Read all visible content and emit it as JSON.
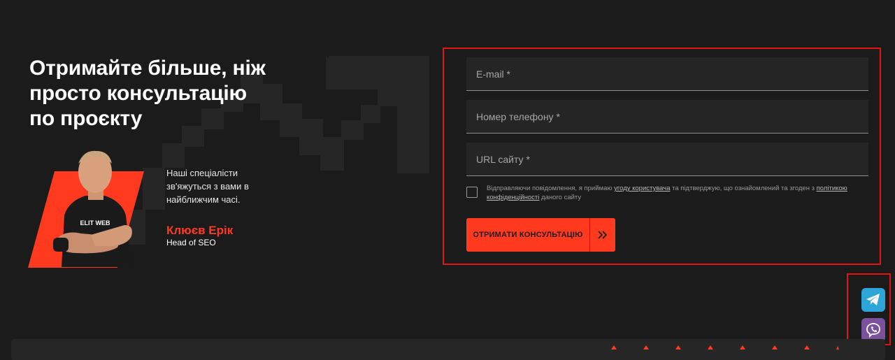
{
  "hero": {
    "title": "Отримайте більше, ніж\nпросто консультацію\nпо проєкту"
  },
  "expert": {
    "description": "Наші спеціалісти\nзв'яжуться з вами в\nнайближчим часі.",
    "name": "Клюєв Ерік",
    "role": "Head of SEO",
    "shirt_text": "ELIT WEB"
  },
  "form": {
    "email_placeholder": "E-mail *",
    "phone_placeholder": "Номер телефону *",
    "url_placeholder": "URL сайту *",
    "email_value": "",
    "phone_value": "",
    "url_value": "",
    "consent_checked": false,
    "consent_prefix": "Відправляючи повідомлення, я приймаю ",
    "consent_link1": "угоду користувача",
    "consent_middle": " та підтверджую, що ознайомлений та згоден з ",
    "consent_link2": "політикою конфіденційності",
    "consent_suffix": " даного сайту",
    "submit_label": "ОТРИМАТИ КОНСУЛЬТАЦІЮ",
    "submit_icon": "double-chevron-right-icon"
  },
  "social": {
    "telegram_icon": "telegram-icon",
    "viber_icon": "viber-icon"
  },
  "colors": {
    "background": "#1b1b1c",
    "accent": "#ff3a1f",
    "highlight_border": "#e11512",
    "field_bg": "#252526",
    "telegram": "#2da5d9",
    "viber": "#7b519d"
  }
}
